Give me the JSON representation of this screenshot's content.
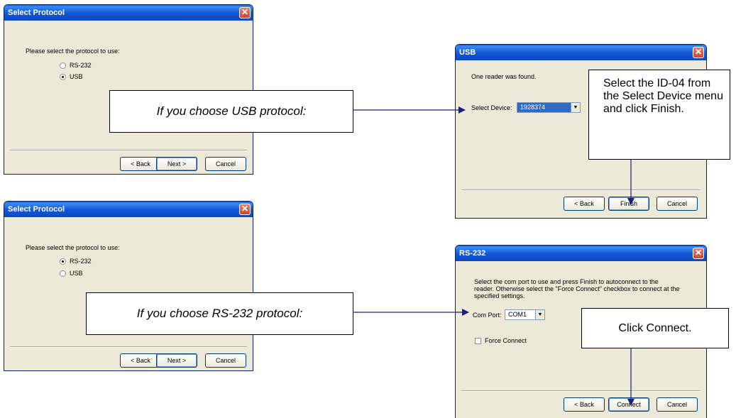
{
  "dialog_usb_select": {
    "title": "Select Protocol",
    "prompt": "Please select the protocol to use:",
    "options": [
      {
        "label": "RS-232",
        "selected": false
      },
      {
        "label": "USB",
        "selected": true
      }
    ],
    "buttons": {
      "back": "< Back",
      "next": "Next >",
      "cancel": "Cancel"
    }
  },
  "dialog_rs232_select": {
    "title": "Select Protocol",
    "prompt": "Please select the protocol to use:",
    "options": [
      {
        "label": "RS-232",
        "selected": true
      },
      {
        "label": "USB",
        "selected": false
      }
    ],
    "buttons": {
      "back": "< Back",
      "next": "Next >",
      "cancel": "Cancel"
    }
  },
  "dialog_usb": {
    "title": "USB",
    "message": "One reader was found.",
    "select_label": "Select Device:",
    "select_value": "1928374",
    "buttons": {
      "back": "< Back",
      "finish": "Finish",
      "cancel": "Cancel"
    }
  },
  "dialog_rs232": {
    "title": "RS-232",
    "message": "Select the com port to use and press Finish to autoconnect to the reader. Otherwise select the \"Force Connect\" checkbox to connect at the specified settings.",
    "port_label": "Com Port:",
    "port_value": "COM1",
    "force_connect_label": "Force Connect",
    "buttons": {
      "back": "< Back",
      "connect": "Connect",
      "cancel": "Cancel"
    }
  },
  "callouts": {
    "usb_protocol": "If you choose USB protocol:",
    "rs232_protocol": "If you choose RS-232 protocol:",
    "usb_instruction": "Select the ID-04 from the Select Device menu and click Finish.",
    "rs232_instruction": "Click Connect."
  },
  "colors": {
    "titlebar": "#0c49c1",
    "dialog_bg": "#ece9d8",
    "arrow": "#1a1f7a",
    "selection": "#316ac5"
  },
  "icons": {
    "close": "close-icon",
    "dropdown": "chevron-down-icon",
    "arrow": "arrow-right-icon"
  }
}
